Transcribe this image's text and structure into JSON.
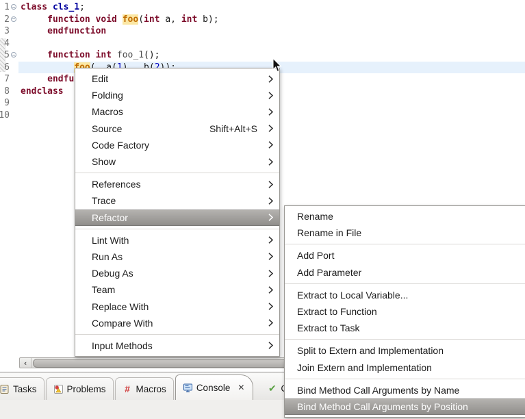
{
  "editor": {
    "lines": [
      {
        "num": "1",
        "fold": true,
        "segments": [
          {
            "t": "class ",
            "c": "kw"
          },
          {
            "t": "cls_1",
            "c": "ident"
          },
          {
            "t": ";",
            "c": "plain"
          }
        ]
      },
      {
        "num": "2",
        "fold": true,
        "segments": [
          {
            "t": "     ",
            "c": "plain"
          },
          {
            "t": "function void ",
            "c": "kw"
          },
          {
            "t": "foo",
            "c": "occurrence"
          },
          {
            "t": "(",
            "c": "plain"
          },
          {
            "t": "int",
            "c": "kw"
          },
          {
            "t": " a, ",
            "c": "plain"
          },
          {
            "t": "int",
            "c": "kw"
          },
          {
            "t": " b);",
            "c": "plain"
          }
        ]
      },
      {
        "num": "3",
        "segments": [
          {
            "t": "     ",
            "c": "plain"
          },
          {
            "t": "endfunction",
            "c": "kw"
          }
        ]
      },
      {
        "num": "4",
        "segments": []
      },
      {
        "num": "5",
        "fold": true,
        "segments": [
          {
            "t": "     ",
            "c": "plain"
          },
          {
            "t": "function int ",
            "c": "kw"
          },
          {
            "t": "foo_1",
            "c": "ident2"
          },
          {
            "t": "();",
            "c": "plain"
          }
        ]
      },
      {
        "num": "6",
        "current": true,
        "segments": [
          {
            "t": "          ",
            "c": "plain"
          },
          {
            "t": "foo",
            "c": "occurrence"
          },
          {
            "t": "( .a(",
            "c": "plain"
          },
          {
            "t": "1",
            "c": "num"
          },
          {
            "t": "), .b(",
            "c": "plain"
          },
          {
            "t": "2",
            "c": "num"
          },
          {
            "t": "));",
            "c": "plain"
          }
        ]
      },
      {
        "num": "7",
        "segments": [
          {
            "t": "     ",
            "c": "plain"
          },
          {
            "t": "endfunction",
            "c": "kw"
          }
        ]
      },
      {
        "num": "8",
        "segments": [
          {
            "t": "endclass",
            "c": "kw"
          }
        ]
      },
      {
        "num": "9",
        "segments": []
      },
      {
        "num": "10",
        "segments": []
      }
    ]
  },
  "context_menu": {
    "items": [
      {
        "label": "Edit",
        "submenu": true
      },
      {
        "label": "Folding",
        "submenu": true
      },
      {
        "label": "Macros",
        "submenu": true
      },
      {
        "label": "Source",
        "accel": "Shift+Alt+S",
        "submenu": true
      },
      {
        "label": "Code Factory",
        "submenu": true
      },
      {
        "label": "Show",
        "submenu": true
      },
      {
        "sep": true
      },
      {
        "label": "References",
        "submenu": true
      },
      {
        "label": "Trace",
        "submenu": true
      },
      {
        "label": "Refactor",
        "submenu": true,
        "highlight": true
      },
      {
        "sep": true
      },
      {
        "label": "Lint With",
        "submenu": true
      },
      {
        "label": "Run As",
        "submenu": true
      },
      {
        "label": "Debug As",
        "submenu": true
      },
      {
        "label": "Team",
        "submenu": true
      },
      {
        "label": "Replace With",
        "submenu": true
      },
      {
        "label": "Compare With",
        "submenu": true
      },
      {
        "sep": true
      },
      {
        "label": "Input Methods",
        "submenu": true
      }
    ]
  },
  "refactor_submenu": {
    "items": [
      {
        "label": "Rename"
      },
      {
        "label": "Rename in File"
      },
      {
        "sep": true
      },
      {
        "label": "Add Port"
      },
      {
        "label": "Add Parameter"
      },
      {
        "sep": true
      },
      {
        "label": "Extract to Local Variable..."
      },
      {
        "label": "Extract to Function"
      },
      {
        "label": "Extract to Task"
      },
      {
        "sep": true
      },
      {
        "label": "Split to Extern and Implementation"
      },
      {
        "label": "Join Extern and Implementation"
      },
      {
        "sep": true
      },
      {
        "label": "Bind Method Call Arguments by Name"
      },
      {
        "label": "Bind Method Call Arguments by Position",
        "highlight": true
      }
    ]
  },
  "bottom_tabs": {
    "tabs": [
      {
        "label": "Tasks",
        "icon": "tasks-icon"
      },
      {
        "label": "Problems",
        "icon": "problems-icon"
      },
      {
        "label": "Macros",
        "icon": "hash-icon"
      },
      {
        "label": "Console",
        "icon": "console-icon",
        "selected": true,
        "closable": true
      },
      {
        "label": "C",
        "icon": "check-icon",
        "truncated": true
      }
    ],
    "hash_glyph": "#",
    "check_glyph": "✔",
    "close_glyph": "✕",
    "scroll_left_glyph": "‹"
  },
  "colors": {
    "keyword": "#7d0d2b",
    "identifier": "#00009e",
    "occurrence_bg": "#fbe7a4",
    "occurrence_text": "#c06c00",
    "number": "#0000c4",
    "current_line_bg": "#e6f1fc",
    "menu_highlight_top": "#b6b4b1",
    "menu_highlight_bottom": "#8e8c89",
    "hash_icon": "#d03c3c",
    "check_icon": "#5ba245"
  }
}
